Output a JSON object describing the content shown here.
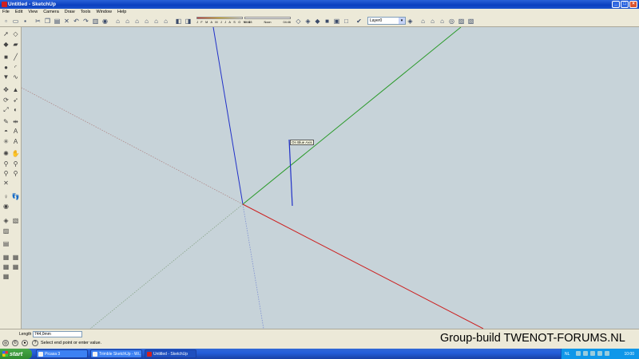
{
  "window": {
    "title": "Untitled - SketchUp",
    "controls": [
      "_",
      "□",
      "×"
    ]
  },
  "menu": [
    "File",
    "Edit",
    "View",
    "Camera",
    "Draw",
    "Tools",
    "Window",
    "Help"
  ],
  "shadow": {
    "months": "J F M A M J J A S O N D",
    "time_start": "06:43",
    "time_mid": "Noon",
    "time_end": "04:46"
  },
  "layer": {
    "current": "Layer0"
  },
  "viewport": {
    "inference_tooltip": "On Blue Axis",
    "axis_colors": {
      "red": "#cc2020",
      "green": "#2a9a2a",
      "blue": "#2030c8"
    }
  },
  "vcb": {
    "label": "Length",
    "value": "744,0mm"
  },
  "status": {
    "prompt": "Select end point or enter value."
  },
  "watermark": "Group-build TWENOT-FORUMS.NL",
  "taskbar": {
    "start": "start",
    "tasks": [
      "Picasa 3",
      "Trimble SketchUp - Wi...",
      "Untitled - SketchUp"
    ],
    "lang": "NL",
    "clock": "10:00"
  }
}
